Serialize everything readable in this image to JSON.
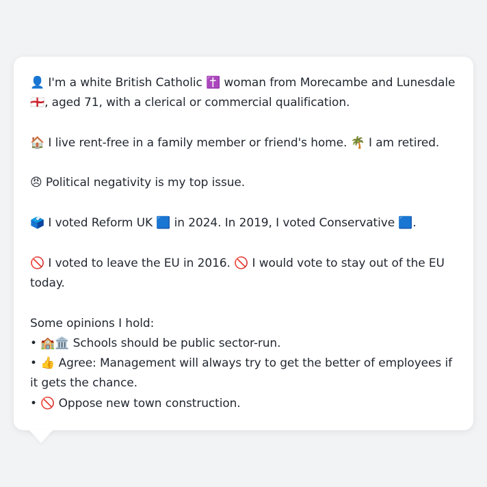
{
  "paragraphs": {
    "identity": "👤 I'm a white British Catholic ✝️ woman from Morecambe and Lunesdale 🏴󠁧󠁢󠁥󠁮󠁧󠁿, aged 71, with a clerical or commercial qualification.",
    "housing": "🏠 I live rent-free in a family member or friend's home. 🌴 I am retired.",
    "issue": "😠 Political negativity is my top issue.",
    "vote": "🗳️ I voted Reform UK 🟦 in 2024. In 2019, I voted Conservative 🟦.",
    "eu": "🚫 I voted to leave the EU in 2016. 🚫 I would vote to stay out of the EU today."
  },
  "opinions": {
    "heading": "Some opinions I hold:",
    "items": [
      "• 🏫🏛️ Schools should be public sector-run.",
      "• 👍 Agree: Management will always try to get the better of employees if it gets the chance.",
      "• 🚫 Oppose new town construction."
    ]
  },
  "colors": {
    "background": "#f2f3f5",
    "card": "#ffffff",
    "text": "#222831"
  }
}
